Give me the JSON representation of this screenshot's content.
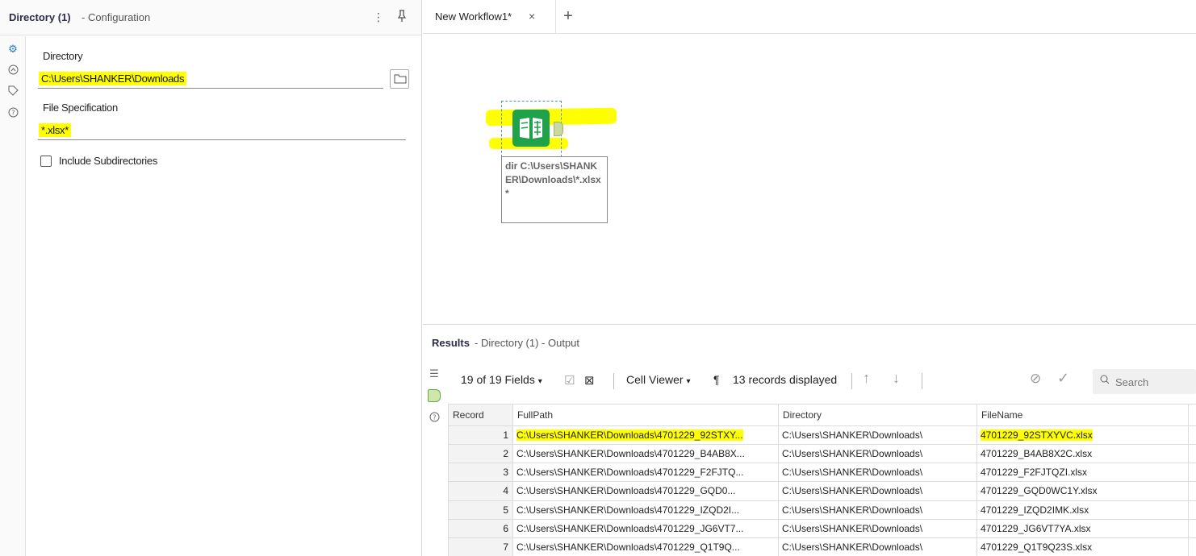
{
  "config": {
    "title": "Directory (1)",
    "subtitle": "- Configuration",
    "more_icon": "kebab-menu-icon",
    "pin_icon": "pin-icon",
    "rail_icons": [
      "gear-icon",
      "connection-icon",
      "tag-icon",
      "help-icon"
    ],
    "directory_label": "Directory",
    "directory_value": "C:\\Users\\SHANKER\\Downloads",
    "file_spec_label": "File Specification",
    "file_spec_value": "*.xlsx*",
    "include_subdirs_label": "Include Subdirectories",
    "include_subdirs_checked": false,
    "highlight_color": "#ffff00"
  },
  "canvas": {
    "tab_label": "New Workflow1*",
    "close_glyph": "×",
    "add_glyph": "+",
    "tool_annotation": "dir C:\\Users\\SHANKER\\Downloads\\*.xlsx*",
    "tool_color": "#1fa24a"
  },
  "results": {
    "title": "Results",
    "subtitle": "- Directory (1) - Output",
    "fields_label": "19 of 19 Fields",
    "cell_viewer_label": "Cell Viewer",
    "pilcrow": "¶",
    "records_label": "13 records displayed",
    "search_placeholder": "Search",
    "columns": [
      "Record",
      "FullPath",
      "Directory",
      "FileName"
    ],
    "rows": [
      {
        "record": "1",
        "fullpath": "C:\\Users\\SHANKER\\Downloads\\4701229_92STXY...",
        "directory": "C:\\Users\\SHANKER\\Downloads\\",
        "filename": "4701229_92STXYVC.xlsx"
      },
      {
        "record": "2",
        "fullpath": "C:\\Users\\SHANKER\\Downloads\\4701229_B4AB8X...",
        "directory": "C:\\Users\\SHANKER\\Downloads\\",
        "filename": "4701229_B4AB8X2C.xlsx"
      },
      {
        "record": "3",
        "fullpath": "C:\\Users\\SHANKER\\Downloads\\4701229_F2FJTQ...",
        "directory": "C:\\Users\\SHANKER\\Downloads\\",
        "filename": "4701229_F2FJTQZI.xlsx"
      },
      {
        "record": "4",
        "fullpath": "C:\\Users\\SHANKER\\Downloads\\4701229_GQD0...",
        "directory": "C:\\Users\\SHANKER\\Downloads\\",
        "filename": "4701229_GQD0WC1Y.xlsx"
      },
      {
        "record": "5",
        "fullpath": "C:\\Users\\SHANKER\\Downloads\\4701229_IZQD2I...",
        "directory": "C:\\Users\\SHANKER\\Downloads\\",
        "filename": "4701229_IZQD2IMK.xlsx"
      },
      {
        "record": "6",
        "fullpath": "C:\\Users\\SHANKER\\Downloads\\4701229_JG6VT7...",
        "directory": "C:\\Users\\SHANKER\\Downloads\\",
        "filename": "4701229_JG6VT7YA.xlsx"
      },
      {
        "record": "7",
        "fullpath": "C:\\Users\\SHANKER\\Downloads\\4701229_Q1T9Q...",
        "directory": "C:\\Users\\SHANKER\\Downloads\\",
        "filename": "4701229_Q1T9Q23S.xlsx"
      }
    ]
  }
}
